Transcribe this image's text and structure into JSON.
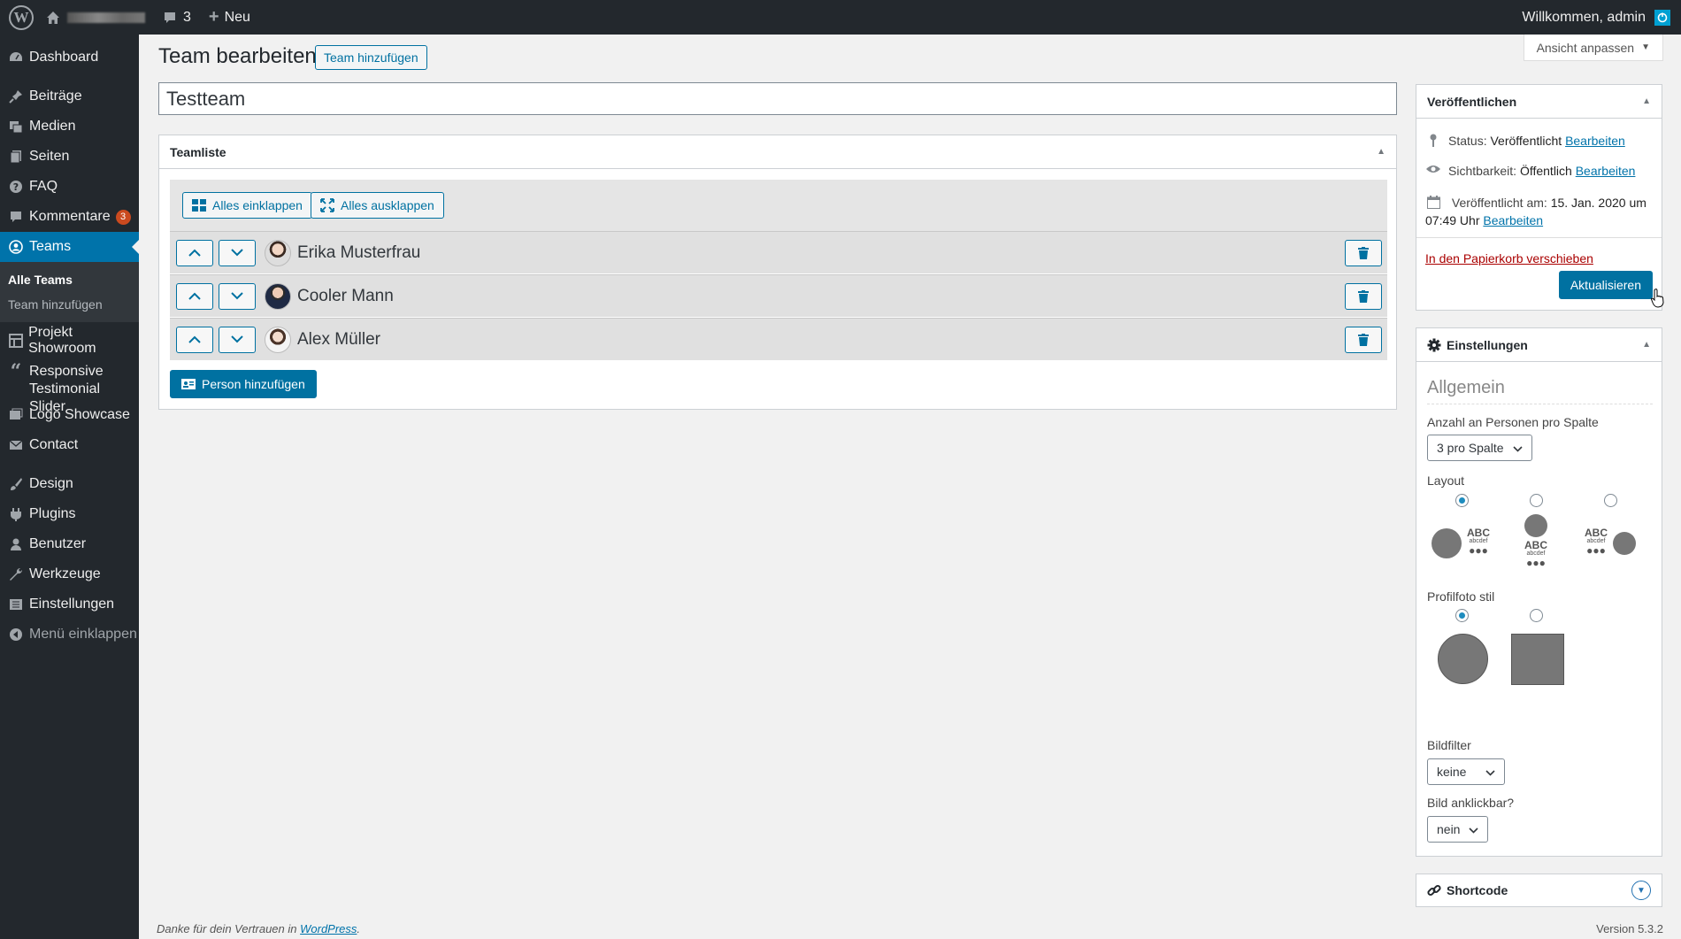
{
  "adminbar": {
    "comments_count": "3",
    "new_label": "Neu",
    "greeting": "Willkommen, admin"
  },
  "sidebar": {
    "items": [
      {
        "label": "Dashboard",
        "icon": "dashboard-icon"
      },
      {
        "label": "Beiträge",
        "icon": "pin-icon"
      },
      {
        "label": "Medien",
        "icon": "media-icon"
      },
      {
        "label": "Seiten",
        "icon": "pages-icon"
      },
      {
        "label": "FAQ",
        "icon": "help-icon"
      },
      {
        "label": "Kommentare",
        "icon": "comment-icon",
        "badge": "3"
      },
      {
        "label": "Teams",
        "icon": "team-icon"
      },
      {
        "label": "Projekt Showroom",
        "icon": "grid-icon"
      },
      {
        "label": "Responsive Testimonial Slider",
        "icon": "quote-icon"
      },
      {
        "label": "Logo Showcase",
        "icon": "images-icon"
      },
      {
        "label": "Contact",
        "icon": "mail-icon"
      },
      {
        "label": "Design",
        "icon": "brush-icon"
      },
      {
        "label": "Plugins",
        "icon": "plugin-icon"
      },
      {
        "label": "Benutzer",
        "icon": "user-icon"
      },
      {
        "label": "Werkzeuge",
        "icon": "wrench-icon"
      },
      {
        "label": "Einstellungen",
        "icon": "settings-icon"
      },
      {
        "label": "Menü einklappen",
        "icon": "collapse-icon"
      }
    ],
    "submenu": {
      "all_teams": "Alle Teams",
      "add_team": "Team hinzufügen"
    }
  },
  "header": {
    "screen_options": "Ansicht anpassen",
    "title": "Team bearbeiten",
    "add_new": "Team hinzufügen",
    "post_title": "Testteam"
  },
  "teamliste": {
    "title": "Teamliste",
    "collapse_all": "Alles einklappen",
    "expand_all": "Alles ausklappen",
    "people": [
      {
        "name": "Erika Musterfrau"
      },
      {
        "name": "Cooler Mann"
      },
      {
        "name": "Alex Müller"
      }
    ],
    "add_person": "Person hinzufügen"
  },
  "publish": {
    "title": "Veröffentlichen",
    "status_label": "Status:",
    "status_value": "Veröffentlicht",
    "visibility_label": "Sichtbarkeit:",
    "visibility_value": "Öffentlich",
    "published_label": "Veröffentlicht am:",
    "published_value": "15. Jan. 2020 um",
    "published_time": "07:49 Uhr",
    "edit_link": "Bearbeiten",
    "trash_link": "In den Papierkorb verschieben",
    "update_button": "Aktualisieren"
  },
  "settings": {
    "title": "Einstellungen",
    "section": "Allgemein",
    "per_column_label": "Anzahl an Personen pro Spalte",
    "per_column_value": "3 pro Spalte",
    "layout_label": "Layout",
    "layout_abc": "ABC",
    "layout_sub": "abcdef",
    "layout_dots": "●●●",
    "photo_style_label": "Profilfoto stil",
    "filter_label": "Bildfilter",
    "filter_value": "keine",
    "clickable_label": "Bild anklickbar?",
    "clickable_value": "nein"
  },
  "shortcode": {
    "title": "Shortcode"
  },
  "footer": {
    "thanks_prefix": "Danke für dein Vertrauen in ",
    "thanks_link": "WordPress",
    "thanks_suffix": ".",
    "version": "Version 5.3.2"
  },
  "colors": {
    "accent": "#0073aa",
    "admin_dark": "#23282d",
    "badge": "#ca4a1f",
    "danger": "#a00"
  }
}
